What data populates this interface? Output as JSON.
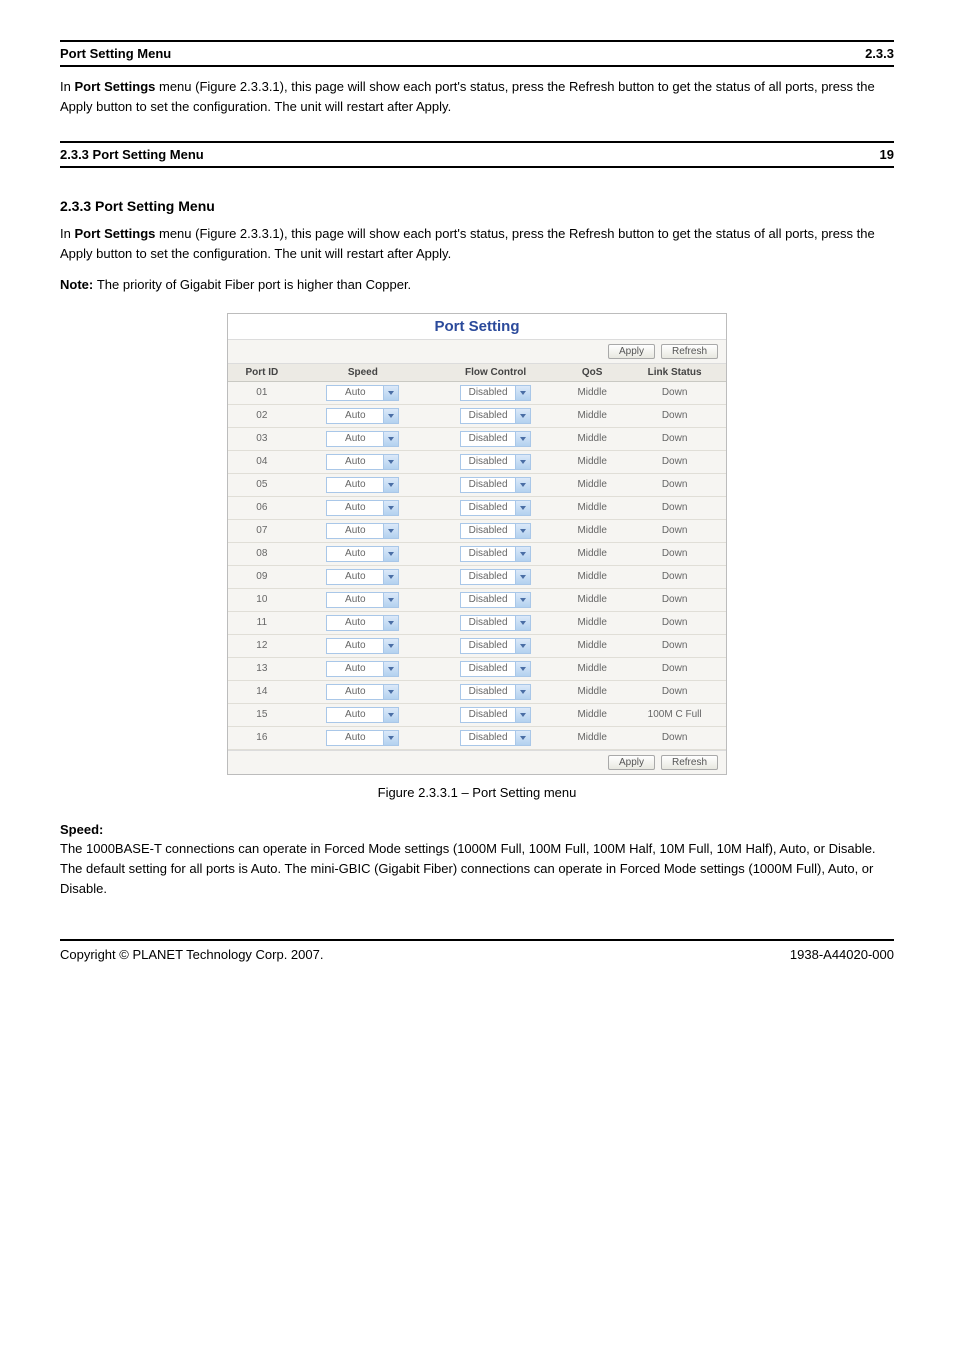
{
  "header": {
    "doc_id_1": "Port Setting Menu",
    "section_no_1": "2.3.3",
    "doc_id_2": "2.3.3 Port Setting Menu",
    "section_no_2": "19"
  },
  "intro": {
    "title": "2.3.3 Port Setting Menu",
    "p1a": "In ",
    "p1b": "Port Settings",
    "p1c": " menu (Figure 2.3.3.1), this page will show each port's status, press the Refresh button to get the status of all ports, press the Apply button to set the configuration. The unit will restart after Apply.",
    "p2a": "Note: ",
    "p2b": "The priority of Gigabit Fiber port is higher than Copper."
  },
  "figure": {
    "title": "Port Setting",
    "buttons": {
      "apply": "Apply",
      "refresh": "Refresh"
    },
    "headers": {
      "port_id": "Port ID",
      "speed": "Speed",
      "flow_control": "Flow Control",
      "qos": "QoS",
      "link_status": "Link Status"
    },
    "rows": [
      {
        "id": "01",
        "speed": "Auto",
        "fc": "Disabled",
        "qos": "Middle",
        "link": "Down"
      },
      {
        "id": "02",
        "speed": "Auto",
        "fc": "Disabled",
        "qos": "Middle",
        "link": "Down"
      },
      {
        "id": "03",
        "speed": "Auto",
        "fc": "Disabled",
        "qos": "Middle",
        "link": "Down"
      },
      {
        "id": "04",
        "speed": "Auto",
        "fc": "Disabled",
        "qos": "Middle",
        "link": "Down"
      },
      {
        "id": "05",
        "speed": "Auto",
        "fc": "Disabled",
        "qos": "Middle",
        "link": "Down"
      },
      {
        "id": "06",
        "speed": "Auto",
        "fc": "Disabled",
        "qos": "Middle",
        "link": "Down"
      },
      {
        "id": "07",
        "speed": "Auto",
        "fc": "Disabled",
        "qos": "Middle",
        "link": "Down"
      },
      {
        "id": "08",
        "speed": "Auto",
        "fc": "Disabled",
        "qos": "Middle",
        "link": "Down"
      },
      {
        "id": "09",
        "speed": "Auto",
        "fc": "Disabled",
        "qos": "Middle",
        "link": "Down"
      },
      {
        "id": "10",
        "speed": "Auto",
        "fc": "Disabled",
        "qos": "Middle",
        "link": "Down"
      },
      {
        "id": "11",
        "speed": "Auto",
        "fc": "Disabled",
        "qos": "Middle",
        "link": "Down"
      },
      {
        "id": "12",
        "speed": "Auto",
        "fc": "Disabled",
        "qos": "Middle",
        "link": "Down"
      },
      {
        "id": "13",
        "speed": "Auto",
        "fc": "Disabled",
        "qos": "Middle",
        "link": "Down"
      },
      {
        "id": "14",
        "speed": "Auto",
        "fc": "Disabled",
        "qos": "Middle",
        "link": "Down"
      },
      {
        "id": "15",
        "speed": "Auto",
        "fc": "Disabled",
        "qos": "Middle",
        "link": "100M C Full"
      },
      {
        "id": "16",
        "speed": "Auto",
        "fc": "Disabled",
        "qos": "Middle",
        "link": "Down"
      }
    ]
  },
  "caption": "Figure 2.3.3.1 – Port Setting menu",
  "defs": {
    "speed_term": "Speed:",
    "speed_text": "The 1000BASE-T connections can operate in Forced Mode settings (1000M Full, 100M Full, 100M Half, 10M Full, 10M Half), Auto, or Disable. The default setting for all ports is Auto. The mini-GBIC (Gigabit Fiber) connections can operate in Forced Mode settings (1000M Full), Auto, or Disable."
  },
  "footer": {
    "left": "Copyright © PLANET Technology Corp. 2007.",
    "right": "1938-A44020-000"
  }
}
